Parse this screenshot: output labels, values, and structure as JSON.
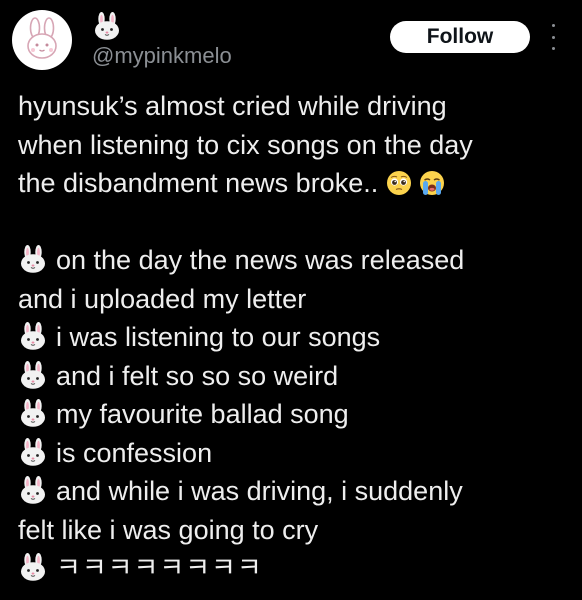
{
  "author": {
    "handle": "@mypinkmelo",
    "name_icon": "rabbit-emoji",
    "avatar": "rabbit-avatar"
  },
  "actions": {
    "follow_label": "Follow",
    "more_icon": "more-vertical-icon"
  },
  "tweet": {
    "intro_lines": [
      "hyunsuk’s almost cried while driving",
      "when listening to cix songs on the day",
      "the disbandment news broke.."
    ],
    "intro_emojis": [
      "pleading-face-emoji",
      "loudly-crying-face-emoji"
    ],
    "bullet_icon": "rabbit-emoji",
    "body_lines": [
      {
        "bullet": true,
        "text": "on the day the news was released"
      },
      {
        "bullet": false,
        "text": "and i uploaded my letter"
      },
      {
        "bullet": true,
        "text": "i was listening to our songs"
      },
      {
        "bullet": true,
        "text": "and i felt so so so weird"
      },
      {
        "bullet": true,
        "text": "my favourite ballad song"
      },
      {
        "bullet": true,
        "text": "is confession"
      },
      {
        "bullet": true,
        "text": "and while i was driving, i suddenly"
      },
      {
        "bullet": false,
        "text": "felt like i was going to cry"
      },
      {
        "bullet": true,
        "text": "ㅋㅋㅋㅋㅋㅋㅋㅋ"
      }
    ]
  },
  "colors": {
    "background": "#000000",
    "text": "#eeeeee",
    "secondary_text": "#8b8f94",
    "button_bg": "#ffffff"
  }
}
